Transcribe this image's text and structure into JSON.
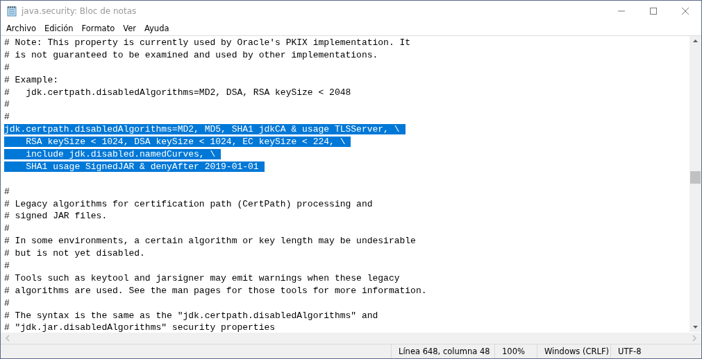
{
  "window": {
    "title": "java.security: Bloc de notas"
  },
  "menu": [
    "Archivo",
    "Edición",
    "Formato",
    "Ver",
    "Ayuda"
  ],
  "editor": {
    "lines": [
      {
        "kind": "text",
        "text": "# Note: This property is currently used by Oracle's PKIX implementation. It",
        "selected": false
      },
      {
        "kind": "text",
        "text": "# is not guaranteed to be examined and used by other implementations.",
        "selected": false
      },
      {
        "kind": "text",
        "text": "#",
        "selected": false
      },
      {
        "kind": "text",
        "text": "# Example:",
        "selected": false
      },
      {
        "kind": "text",
        "text": "#   jdk.certpath.disabledAlgorithms=MD2, DSA, RSA keySize < 2048",
        "selected": false
      },
      {
        "kind": "text",
        "text": "#",
        "selected": false
      },
      {
        "kind": "text",
        "text": "#",
        "selected": false
      },
      {
        "kind": "text",
        "text": "jdk.certpath.disabledAlgorithms=MD2, MD5, SHA1 jdkCA & usage TLSServer, \\",
        "selected": true
      },
      {
        "kind": "text",
        "text": "    RSA keySize < 1024, DSA keySize < 1024, EC keySize < 224, \\",
        "selected": true
      },
      {
        "kind": "text",
        "text": "    include jdk.disabled.namedCurves, \\",
        "selected": true
      },
      {
        "kind": "text",
        "text": "    SHA1 usage SignedJAR & denyAfter 2019-01-01",
        "selected": true
      },
      {
        "kind": "blank"
      },
      {
        "kind": "text",
        "text": "#",
        "selected": false
      },
      {
        "kind": "text",
        "text": "# Legacy algorithms for certification path (CertPath) processing and",
        "selected": false
      },
      {
        "kind": "text",
        "text": "# signed JAR files.",
        "selected": false
      },
      {
        "kind": "text",
        "text": "#",
        "selected": false
      },
      {
        "kind": "text",
        "text": "# In some environments, a certain algorithm or key length may be undesirable",
        "selected": false
      },
      {
        "kind": "text",
        "text": "# but is not yet disabled.",
        "selected": false
      },
      {
        "kind": "text",
        "text": "#",
        "selected": false
      },
      {
        "kind": "text",
        "text": "# Tools such as keytool and jarsigner may emit warnings when these legacy",
        "selected": false
      },
      {
        "kind": "text",
        "text": "# algorithms are used. See the man pages for those tools for more information.",
        "selected": false
      },
      {
        "kind": "text",
        "text": "#",
        "selected": false
      },
      {
        "kind": "text",
        "text": "# The syntax is the same as the \"jdk.certpath.disabledAlgorithms\" and",
        "selected": false
      },
      {
        "kind": "text",
        "text": "# \"jdk.jar.disabledAlgorithms\" security properties",
        "selected": false
      }
    ]
  },
  "status_bar": [
    "Línea 648, columna 48",
    "100%",
    "Windows (CRLF)",
    "UTF-8"
  ]
}
